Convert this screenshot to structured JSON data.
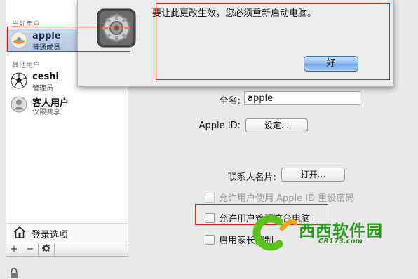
{
  "sidebar": {
    "current_users_title": "当前用户",
    "current_user": {
      "name": "apple",
      "role": "普通成员"
    },
    "other_users_title": "其他用户",
    "other_users": [
      {
        "name": "ceshi",
        "role": "管理员"
      },
      {
        "name": "客人用户",
        "role": "仅限共享"
      }
    ],
    "login_options": "登录选项",
    "add_symbol": "+",
    "remove_symbol": "−"
  },
  "main": {
    "fullname_label": "全名:",
    "fullname_value": "apple",
    "appleid_label": "Apple ID:",
    "appleid_button": "设定...",
    "contact_card_label": "联系人名片:",
    "contact_card_button": "打开...",
    "reset_password_check": "允许用户使用 Apple ID 重设密码",
    "admin_check": "允许用户管理这台电脑",
    "parental_check": "启用家长控制"
  },
  "dialog": {
    "message": "要让此更改生效，您必须重新启动电脑。",
    "ok_button": "好"
  },
  "watermark": {
    "name": "西西软件园",
    "site": "CR173.com"
  },
  "colors": {
    "highlight": "#e21b1b",
    "accent": "#6fa4e6"
  }
}
